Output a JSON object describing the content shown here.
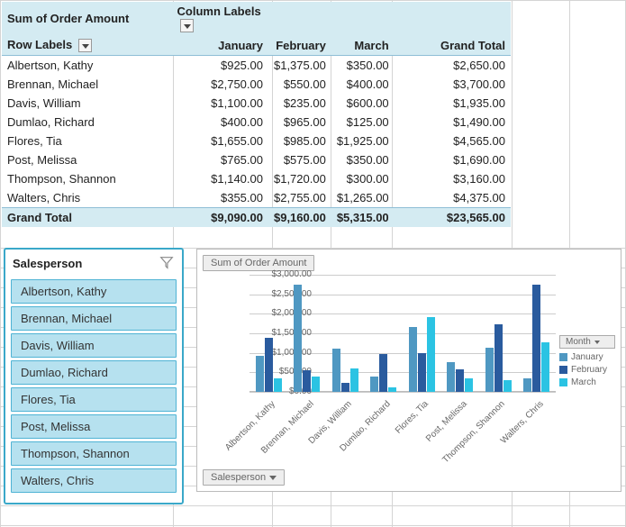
{
  "pivot": {
    "sum_label": "Sum of Order Amount",
    "col_labels": "Column Labels",
    "row_labels": "Row Labels",
    "columns": [
      "January",
      "February",
      "March",
      "Grand Total"
    ],
    "rows": [
      {
        "name": "Albertson, Kathy",
        "cells": [
          "$925.00",
          "$1,375.00",
          "$350.00",
          "$2,650.00"
        ]
      },
      {
        "name": "Brennan, Michael",
        "cells": [
          "$2,750.00",
          "$550.00",
          "$400.00",
          "$3,700.00"
        ]
      },
      {
        "name": "Davis, William",
        "cells": [
          "$1,100.00",
          "$235.00",
          "$600.00",
          "$1,935.00"
        ]
      },
      {
        "name": "Dumlao, Richard",
        "cells": [
          "$400.00",
          "$965.00",
          "$125.00",
          "$1,490.00"
        ]
      },
      {
        "name": "Flores, Tia",
        "cells": [
          "$1,655.00",
          "$985.00",
          "$1,925.00",
          "$4,565.00"
        ]
      },
      {
        "name": "Post, Melissa",
        "cells": [
          "$765.00",
          "$575.00",
          "$350.00",
          "$1,690.00"
        ]
      },
      {
        "name": "Thompson, Shannon",
        "cells": [
          "$1,140.00",
          "$1,720.00",
          "$300.00",
          "$3,160.00"
        ]
      },
      {
        "name": "Walters, Chris",
        "cells": [
          "$355.00",
          "$2,755.00",
          "$1,265.00",
          "$4,375.00"
        ]
      }
    ],
    "grand_label": "Grand Total",
    "grand_cells": [
      "$9,090.00",
      "$9,160.00",
      "$5,315.00",
      "$23,565.00"
    ]
  },
  "slicer": {
    "title": "Salesperson",
    "items": [
      "Albertson, Kathy",
      "Brennan, Michael",
      "Davis, William",
      "Dumlao, Richard",
      "Flores, Tia",
      "Post, Melissa",
      "Thompson, Shannon",
      "Walters, Chris"
    ]
  },
  "chart_buttons": {
    "top": "Sum of Order Amount",
    "bottom": "Salesperson",
    "legend": "Month"
  },
  "chart_data": {
    "type": "bar",
    "title": "",
    "xlabel": "",
    "ylabel": "",
    "ylim": [
      0,
      3000
    ],
    "ytick_labels": [
      "$0.00",
      "$500.00",
      "$1,000.00",
      "$1,500.00",
      "$2,000.00",
      "$2,500.00",
      "$3,000.00"
    ],
    "categories": [
      "Albertson, Kathy",
      "Brennan, Michael",
      "Davis, William",
      "Dumlao, Richard",
      "Flores, Tia",
      "Post, Melissa",
      "Thompson, Shannon",
      "Walters, Chris"
    ],
    "series": [
      {
        "name": "January",
        "color": "#4f98c2",
        "values": [
          925,
          2750,
          1100,
          400,
          1655,
          765,
          1140,
          355
        ]
      },
      {
        "name": "February",
        "color": "#2a5b9e",
        "values": [
          1375,
          550,
          235,
          965,
          985,
          575,
          1720,
          2755
        ]
      },
      {
        "name": "March",
        "color": "#2bc3e3",
        "values": [
          350,
          400,
          600,
          125,
          1925,
          350,
          300,
          1265
        ]
      }
    ]
  }
}
